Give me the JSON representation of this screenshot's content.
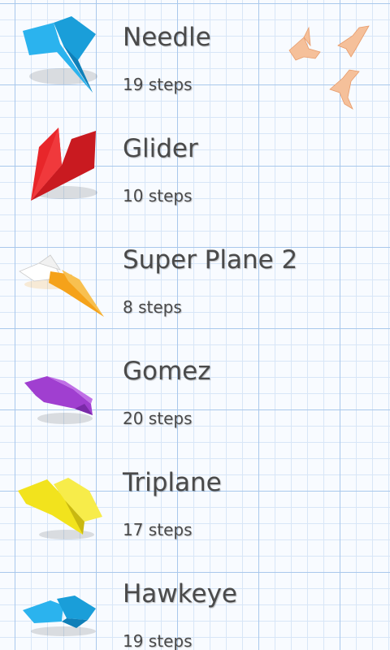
{
  "planes": [
    {
      "name": "Needle",
      "steps": "19 steps",
      "icon": "needle-plane-icon",
      "color": "#29aee8"
    },
    {
      "name": "Glider",
      "steps": "10 steps",
      "icon": "glider-plane-icon",
      "color": "#e8262a"
    },
    {
      "name": "Super Plane 2",
      "steps": "8 steps",
      "icon": "super-plane-2-icon",
      "color": "#f5a21a"
    },
    {
      "name": "Gomez",
      "steps": "20 steps",
      "icon": "gomez-plane-icon",
      "color": "#a03fd0"
    },
    {
      "name": "Triplane",
      "steps": "17 steps",
      "icon": "triplane-plane-icon",
      "color": "#f2e31d"
    },
    {
      "name": "Hawkeye",
      "steps": "19 steps",
      "icon": "hawkeye-plane-icon",
      "color": "#29aee8"
    }
  ],
  "decoration": {
    "icon": "origami-birds-icon",
    "color": "#f2b48a"
  }
}
